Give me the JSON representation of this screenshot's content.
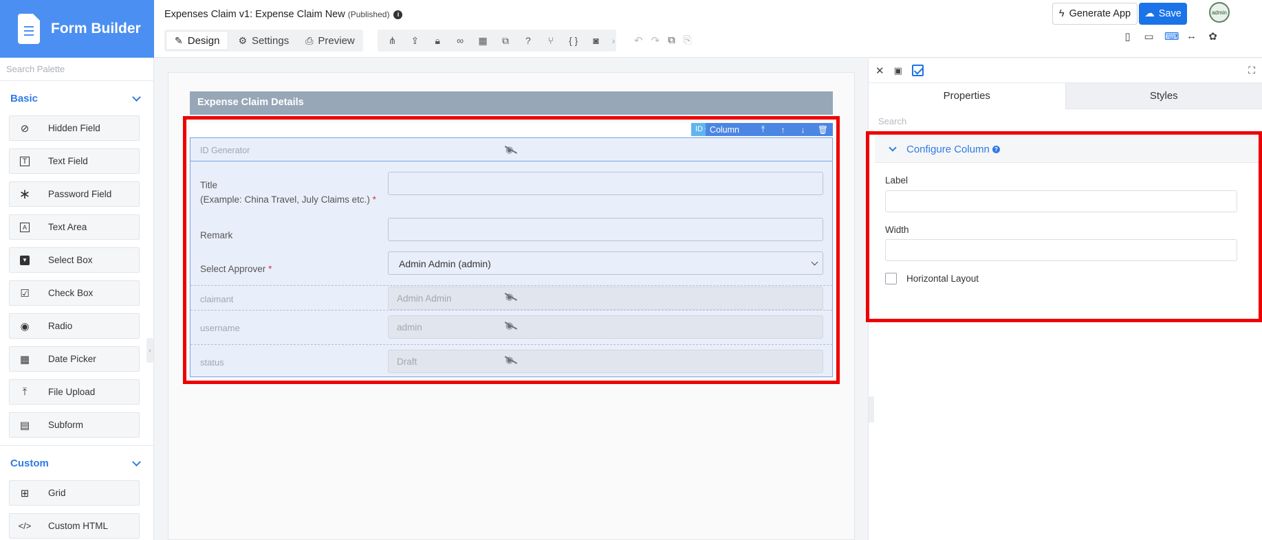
{
  "brand": {
    "title": "Form Builder"
  },
  "palette": {
    "search_placeholder": "Search Palette",
    "groups": [
      {
        "name": "Basic",
        "items": [
          {
            "label": "Hidden Field",
            "icon": "eye-slash-icon"
          },
          {
            "label": "Text Field",
            "icon": "text-field-icon"
          },
          {
            "label": "Password Field",
            "icon": "asterisk-icon"
          },
          {
            "label": "Text Area",
            "icon": "text-area-icon"
          },
          {
            "label": "Select Box",
            "icon": "select-box-icon"
          },
          {
            "label": "Check Box",
            "icon": "check-box-icon"
          },
          {
            "label": "Radio",
            "icon": "radio-icon"
          },
          {
            "label": "Date Picker",
            "icon": "calendar-icon"
          },
          {
            "label": "File Upload",
            "icon": "upload-icon"
          },
          {
            "label": "Subform",
            "icon": "subform-icon"
          }
        ]
      },
      {
        "name": "Custom",
        "items": [
          {
            "label": "Grid",
            "icon": "grid-icon"
          },
          {
            "label": "Custom HTML",
            "icon": "code-icon"
          }
        ]
      }
    ]
  },
  "header": {
    "app_title": "Expenses Claim v1: Expense Claim New",
    "status": "(Published)",
    "tabs": [
      {
        "label": "Design",
        "icon": "design-icon",
        "active": true
      },
      {
        "label": "Settings",
        "icon": "gear-icon",
        "active": false
      },
      {
        "label": "Preview",
        "icon": "preview-icon",
        "active": false
      }
    ],
    "generate_label": "Generate App",
    "save_label": "Save",
    "avatar_text": "admin"
  },
  "canvas": {
    "section_title": "Expense Claim Details",
    "column_bar": {
      "id_tag": "ID G",
      "label": "Column"
    },
    "fields": {
      "id_generator": "ID Generator",
      "title_label": "Title",
      "title_hint": "(Example: China Travel, July Claims etc.)",
      "remark_label": "Remark",
      "approver_label": "Select Approver",
      "approver_value": "Admin Admin (admin)",
      "claimant_label": "claimant",
      "claimant_value": "Admin Admin",
      "username_label": "username",
      "username_value": "admin",
      "status_label": "status",
      "status_value": "Draft",
      "required_mark": "*"
    }
  },
  "properties": {
    "tab_properties": "Properties",
    "tab_styles": "Styles",
    "search_placeholder": "Search",
    "section_title": "Configure Column",
    "label_field": "Label",
    "width_field": "Width",
    "horizontal_layout": "Horizontal Layout"
  },
  "colors": {
    "brand": "#4c8ff2",
    "accent": "#1a73e8",
    "highlight": "#ee0000"
  }
}
